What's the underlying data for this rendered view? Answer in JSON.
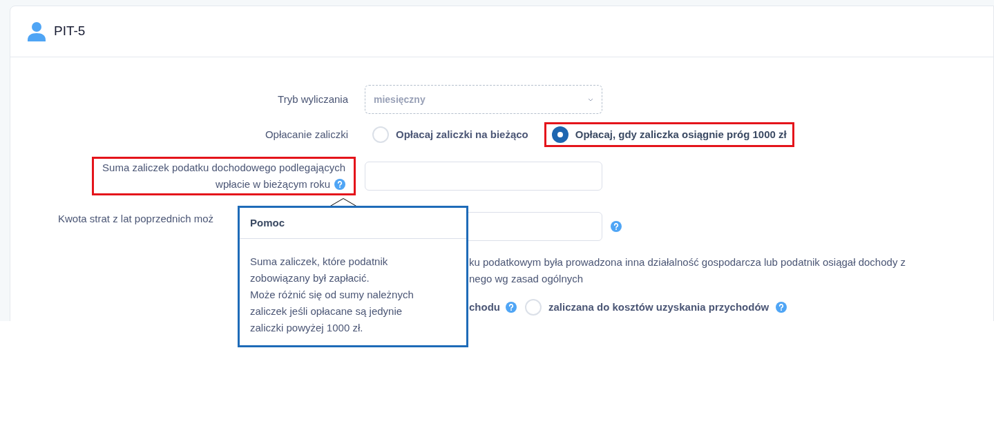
{
  "header": {
    "title": "PIT-5"
  },
  "rows": [
    {
      "kind": "select",
      "label": "Tryb wyliczania",
      "value": "miesięczny",
      "disabled": true
    },
    {
      "kind": "radio",
      "label": "Opłacanie zaliczki",
      "options": [
        {
          "label": "Opłacaj zaliczki na bieżąco",
          "selected": false,
          "highlighted": false
        },
        {
          "label": "Opłacaj, gdy zaliczka osiągnie próg 1000 zł",
          "selected": true,
          "highlighted": true
        }
      ]
    },
    {
      "kind": "input",
      "label_lines": [
        "Suma zaliczek podatku dochodowego podlegających",
        "wpłacie w bieżącym roku"
      ],
      "help": true,
      "highlighted": true
    },
    {
      "kind": "input",
      "label_lines": [
        "Kwota strat z lat poprzednich moż"
      ],
      "help_after": true,
      "highlighted": false
    }
  ],
  "note_lines": [
    "ku podatkowym była prowadzona inna działalność gospodarcza lub podatnik osiągał dochody z",
    "nego wg zasad ogólnych"
  ],
  "cost_row": {
    "fragment": "chodu",
    "fragment_help": true,
    "options": [
      {
        "label": "zaliczana do kosztów uzyskania przychodów",
        "selected": false,
        "help": true
      }
    ]
  },
  "popover": {
    "title": "Pomoc",
    "paragraphs": [
      "Suma zaliczek, które podatnik zobowiązany był zapłacić.",
      "Może różnić się od sumy należnych zaliczek jeśli opłacane są jedynie zaliczki powyżej 1000 zł."
    ]
  }
}
